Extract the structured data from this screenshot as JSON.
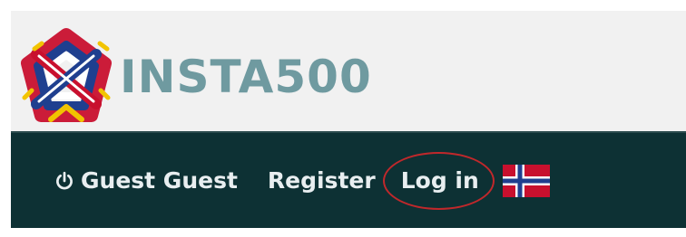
{
  "brand": {
    "name": "INSTA500"
  },
  "nav": {
    "guest_label": "Guest Guest",
    "register_label": "Register",
    "login_label": "Log in"
  },
  "colors": {
    "header_bg": "#f1f1f1",
    "navbar_bg": "#0d3134",
    "brand_text": "#6f9aa0",
    "nav_text": "#e8eef0",
    "highlight_circle": "#c0282b"
  },
  "icons": {
    "power": "power-icon",
    "flag": "norway-flag-icon",
    "logo": "star-logo-icon"
  }
}
